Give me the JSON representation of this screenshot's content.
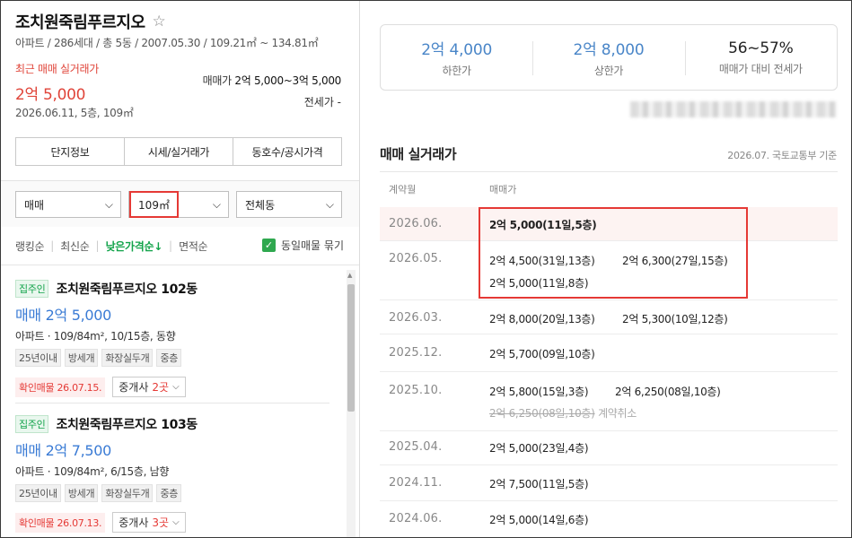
{
  "left": {
    "complex_name": "조치원죽림푸르지오",
    "summary": "아파트 / 286세대 / 총 5동 / 2007.05.30 / 109.21㎡ ~ 134.81㎡",
    "recent": {
      "label": "최근 매매 실거래가",
      "price": "2억 5,000",
      "date": "2026.06.11, 5층, 109㎡"
    },
    "trade_range": {
      "label": "매매가",
      "value": "2억 5,000~3억 5,000"
    },
    "jeonse": "전세가 -",
    "tabs": [
      "단지정보",
      "시세/실거래가",
      "동호수/공시가격"
    ],
    "filters": {
      "type": "매매",
      "area": "109㎡",
      "building": "전체동"
    },
    "sort": {
      "items": [
        "랭킹순",
        "최신순",
        "낮은가격순↓",
        "면적순"
      ],
      "active": "낮은가격순↓",
      "checkbox_label": "동일매물 묶기",
      "checkbox_checked": true
    },
    "listings": [
      {
        "badge": "집주인",
        "name": "조치원죽림푸르지오 102동",
        "price": "매매 2억 5,000",
        "spec": "아파트 · 109/84m², 10/15층, 동향",
        "tags": [
          "25년이내",
          "방세개",
          "화장실두개",
          "중층"
        ],
        "confirm": "확인매물 26.07.15.",
        "broker_label": "중개사",
        "broker_count": "2곳"
      },
      {
        "badge": "집주인",
        "name": "조치원죽림푸르지오 103동",
        "price": "매매 2억 7,500",
        "spec": "아파트 · 109/84m², 6/15층, 남향",
        "tags": [
          "25년이내",
          "방세개",
          "화장실두개",
          "중층"
        ],
        "confirm": "확인매물 26.07.13.",
        "broker_label": "중개사",
        "broker_count": "3곳"
      }
    ]
  },
  "right": {
    "stats": [
      {
        "value": "2억 4,000",
        "label": "하한가"
      },
      {
        "value": "2억 8,000",
        "label": "상한가"
      },
      {
        "value": "56~57%",
        "label": "매매가 대비 전세가"
      }
    ],
    "section_title": "매매 실거래가",
    "section_source": "2026.07. 국토교통부 기준",
    "columns": [
      "계약월",
      "매매가"
    ],
    "rows": [
      {
        "month": "2026.06.",
        "deals": [
          "2억 5,000(11일,5층)"
        ]
      },
      {
        "month": "2026.05.",
        "deals": [
          "2억 4,500(31일,13층)",
          "2억 6,300(27일,15층)",
          "2억 5,000(11일,8층)"
        ]
      },
      {
        "month": "2026.03.",
        "deals": [
          "2억 8,000(20일,13층)",
          "2억 5,300(10일,12층)"
        ]
      },
      {
        "month": "2025.12.",
        "deals": [
          "2억 5,700(09일,10층)"
        ]
      },
      {
        "month": "2025.10.",
        "deals": [
          "2억 5,800(15일,3층)",
          "2억 6,250(08일,10층)"
        ],
        "cancelled_deal": "2억 6,250(08일,10층)",
        "cancel_note": "계약취소"
      },
      {
        "month": "2025.04.",
        "deals": [
          "2억 5,000(23일,4층)"
        ]
      },
      {
        "month": "2024.11.",
        "deals": [
          "2억 7,500(11일,5층)"
        ]
      },
      {
        "month": "2024.06.",
        "deals": [
          "2억 5,000(14일,6층)"
        ]
      }
    ]
  },
  "colors": {
    "accent_red": "#e53935",
    "price_blue": "#3a7bd5",
    "active_green": "#12a34a"
  }
}
